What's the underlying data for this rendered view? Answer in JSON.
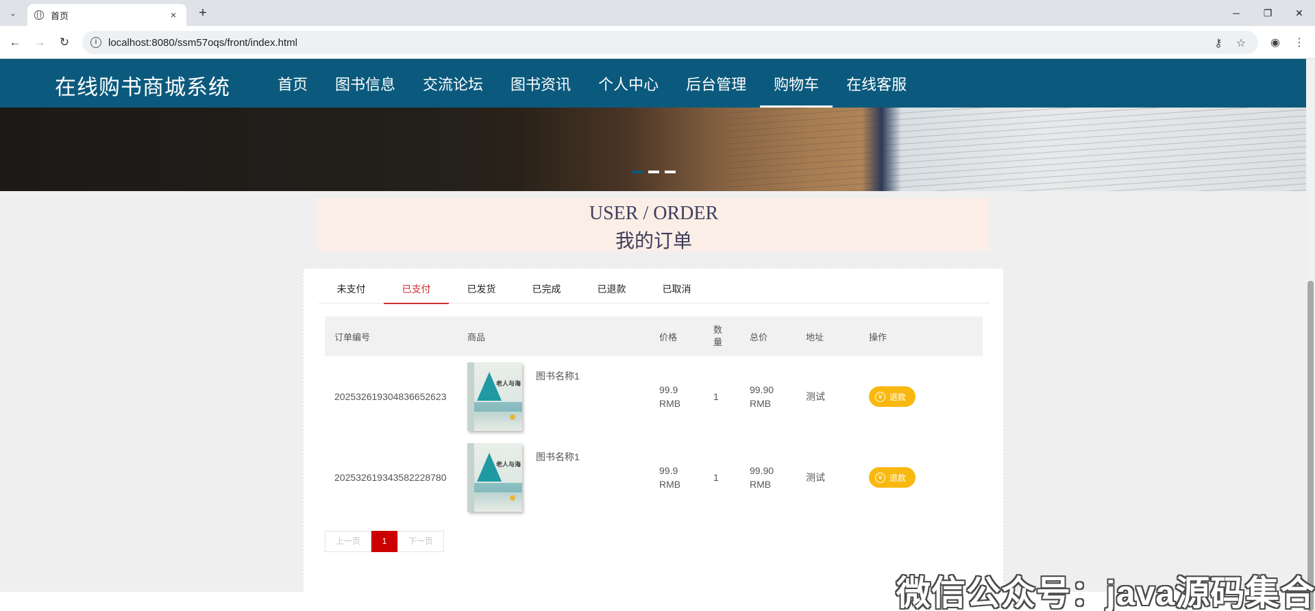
{
  "browser": {
    "tab_title": "首页",
    "tab_close": "×",
    "new_tab": "+",
    "url": "localhost:8080/ssm57oqs/front/index.html"
  },
  "header": {
    "site_title": "在线购书商城系统",
    "nav": [
      "首页",
      "图书信息",
      "交流论坛",
      "图书资讯",
      "个人中心",
      "后台管理",
      "购物车",
      "在线客服"
    ],
    "active_nav_index": 6
  },
  "page_title": {
    "en": "USER / ORDER",
    "cn": "我的订单"
  },
  "order_tabs": {
    "items": [
      "未支付",
      "已支付",
      "已发货",
      "已完成",
      "已退款",
      "已取消"
    ],
    "active_index": 1
  },
  "table": {
    "headers": [
      "订单编号",
      "商品",
      "价格",
      "数量",
      "总价",
      "地址",
      "操作"
    ],
    "rows": [
      {
        "order_no": "2025326193048366526​23",
        "goods_name": "图书名称1",
        "price": "99.9 RMB",
        "quantity": "1",
        "total": "99.90 RMB",
        "address": "测试",
        "action": "退款"
      },
      {
        "order_no": "20253261934358222878​0",
        "goods_name": "图书名称1",
        "price": "99.9 RMB",
        "quantity": "1",
        "total": "99.90 RMB",
        "address": "测试",
        "action": "退款"
      }
    ]
  },
  "book_cover_text": "老人与海",
  "pagination": {
    "prev": "上一页",
    "current": "1",
    "next": "下一页"
  },
  "watermark": "微信公众号：java源码集合",
  "colors": {
    "header_bg": "#0b5a7d",
    "active_tab": "#c9302c",
    "refund_button": "#f8b80f",
    "pager_current": "#cc0000",
    "title_block_bg": "#fbeee6"
  },
  "icons": {
    "refund": "yen-circle-icon"
  }
}
